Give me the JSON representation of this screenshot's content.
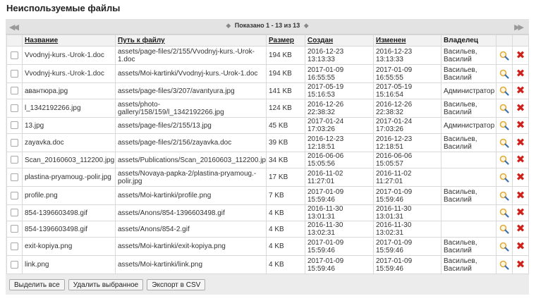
{
  "page_title": "Неиспользуемые файлы",
  "pager": {
    "label": "Показано 1 - 13 из 13",
    "first_glyph": "◀◀",
    "prev_glyph": "◆",
    "next_glyph": "◆",
    "last_glyph": "▶▶"
  },
  "columns": {
    "name": "Название",
    "path": "Путь к файлу",
    "size": "Размер",
    "created": "Создан",
    "modified": "Изменен",
    "owner": "Владелец"
  },
  "rows": [
    {
      "name": "Vvodnyj-kurs.-Urok-1.doc",
      "path": "assets/page-files/2/155/Vvodnyj-kurs.-Urok-1.doc",
      "size": "194 KB",
      "created": "2016-12-23 13:13:33",
      "modified": "2016-12-23 13:13:33",
      "owner": "Васильев, Василий"
    },
    {
      "name": "Vvodnyj-kurs.-Urok-1.doc",
      "path": "assets/Moi-kartinki/Vvodnyj-kurs.-Urok-1.doc",
      "size": "194 KB",
      "created": "2017-01-09 16:55:55",
      "modified": "2017-01-09 16:55:55",
      "owner": "Васильев, Василий"
    },
    {
      "name": "авантюра.jpg",
      "path": "assets/page-files/3/207/avantyura.jpg",
      "size": "141 KB",
      "created": "2017-05-19 15:16:53",
      "modified": "2017-05-19 15:16:54",
      "owner": "Администратор"
    },
    {
      "name": "l_1342192266.jpg",
      "path": "assets/photo-gallery/158/159/l_1342192266.jpg",
      "size": "124 KB",
      "created": "2016-12-26 22:38:32",
      "modified": "2016-12-26 22:38:32",
      "owner": "Васильев, Василий"
    },
    {
      "name": "13.jpg",
      "path": "assets/page-files/2/155/13.jpg",
      "size": "45 KB",
      "created": "2017-01-24 17:03:26",
      "modified": "2017-01-24 17:03:26",
      "owner": "Администратор"
    },
    {
      "name": "zayavka.doc",
      "path": "assets/page-files/2/156/zayavka.doc",
      "size": "39 KB",
      "created": "2016-12-23 12:18:51",
      "modified": "2016-12-23 12:18:51",
      "owner": "Васильев, Василий"
    },
    {
      "name": "Scan_20160603_112200.jpg",
      "path": "assets/Publications/Scan_20160603_112200.jpg",
      "size": "34 KB",
      "created": "2016-06-06 15:05:56",
      "modified": "2016-06-06 15:05:57",
      "owner": ""
    },
    {
      "name": "plastina-pryamoug.-polir.jpg",
      "path": "assets/Novaya-papka-2/plastina-pryamoug.-polir.jpg",
      "size": "17 KB",
      "created": "2016-11-02 11:27:01",
      "modified": "2016-11-02 11:27:01",
      "owner": ""
    },
    {
      "name": "profile.png",
      "path": "assets/Moi-kartinki/profile.png",
      "size": "7 KB",
      "created": "2017-01-09 15:59:46",
      "modified": "2017-01-09 15:59:46",
      "owner": "Васильев, Василий"
    },
    {
      "name": "854-1396603498.gif",
      "path": "assets/Anons/854-1396603498.gif",
      "size": "4 KB",
      "created": "2016-11-30 13:01:31",
      "modified": "2016-11-30 13:01:31",
      "owner": ""
    },
    {
      "name": "854-1396603498.gif",
      "path": "assets/Anons/854-2.gif",
      "size": "4 KB",
      "created": "2016-11-30 13:02:31",
      "modified": "2016-11-30 13:02:31",
      "owner": ""
    },
    {
      "name": "exit-kopiya.png",
      "path": "assets/Moi-kartinki/exit-kopiya.png",
      "size": "4 KB",
      "created": "2017-01-09 15:59:46",
      "modified": "2017-01-09 15:59:46",
      "owner": "Васильев, Василий"
    },
    {
      "name": "link.png",
      "path": "assets/Moi-kartinki/link.png",
      "size": "4 KB",
      "created": "2017-01-09 15:59:46",
      "modified": "2017-01-09 15:59:46",
      "owner": "Васильев, Василий"
    }
  ],
  "icons": {
    "view": "magnifier-icon",
    "delete": "delete-x-icon",
    "delete_glyph": "✖"
  },
  "colors": {
    "delete": "#d0201a",
    "magnifier": "#e0a93a",
    "panel_bg": "#ececec"
  },
  "buttons": {
    "select_all": "Выделить все",
    "delete_selected": "Удалить выбранное",
    "export_csv": "Экспорт в CSV"
  }
}
